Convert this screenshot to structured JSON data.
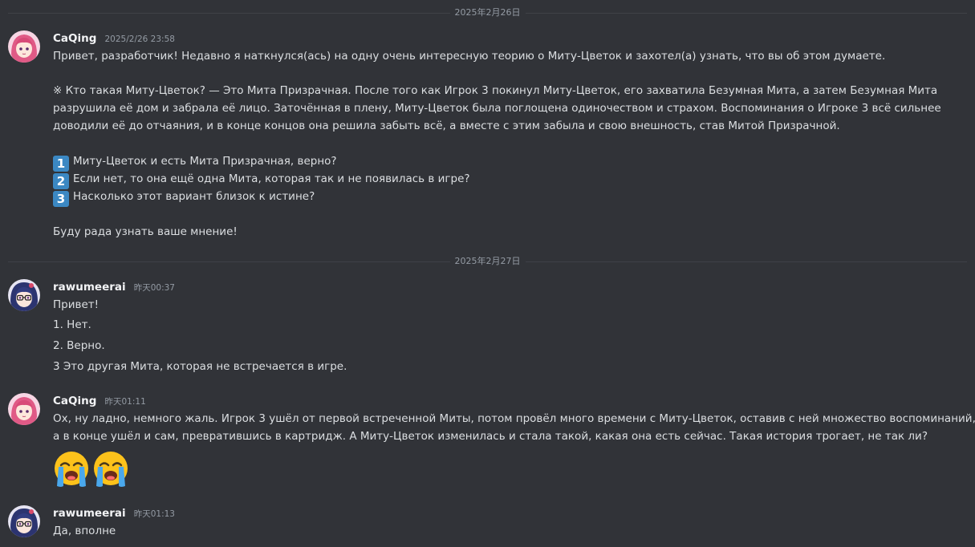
{
  "dividers": [
    "2025年2月26日",
    "2025年2月27日"
  ],
  "messages": [
    {
      "username": "CaQing",
      "timestamp": "2025/2/26 23:58",
      "lines": [
        "Привет, разработчик! Недавно я наткнулся(ась) на одну очень интересную теорию о Миту-Цветок и захотел(а) узнать, что вы об этом думаете.",
        "※ Кто такая Миту-Цветок? — Это Мита Призрачная. После того как Игрок 3 покинул Миту-Цветок, его захватила Безумная Мита, а затем Безумная Мита",
        "разрушила её дом и забрала её лицо. Заточённая в плену, Миту-Цветок была поглощена одиночеством и страхом. Воспоминания о Игроке 3 всё сильнее",
        "доводили её до отчаяния, и в конце концов она решила забыть всё, а вместе с этим забыла и свою внешность, став Митой Призрачной."
      ],
      "list": [
        {
          "num": "1",
          "text": "Миту-Цветок и есть Мита Призрачная, верно?"
        },
        {
          "num": "2",
          "text": "Если нет, то она ещё одна Мита, которая так и не появилась в игре?"
        },
        {
          "num": "3",
          "text": "Насколько этот вариант близок к истине?"
        }
      ],
      "closing": "Буду рада узнать ваше мнение!"
    },
    {
      "username": "rawumeerai",
      "timestamp": "昨天00:37",
      "lines": [
        "Привет!",
        "1. Нет.",
        "2. Верно.",
        "3 Это другая Мита, которая не встречается в игре."
      ]
    },
    {
      "username": "CaQing",
      "timestamp": "昨天01:11",
      "lines": [
        "Ох, ну ладно, немного жаль. Игрок 3 ушёл от первой встреченной Миты, потом провёл много времени с Миту-Цветок, оставив с ней множество воспоминаний,",
        "а в конце ушёл и сам, превратившись в картридж. А Миту-Цветок изменилась и стала такой, какая она есть сейчас. Такая история трогает, не так ли?"
      ],
      "reactions": [
        "loudly-crying-face-icon",
        "loudly-crying-face-icon"
      ]
    },
    {
      "username": "rawumeerai",
      "timestamp": "昨天01:13",
      "lines": [
        "Да, вполне"
      ]
    }
  ],
  "colors": {
    "background": "#313338",
    "text": "#dbdee1",
    "username": "#f2f3f5",
    "muted": "#949ba4",
    "keycap": "#3b88c3"
  }
}
